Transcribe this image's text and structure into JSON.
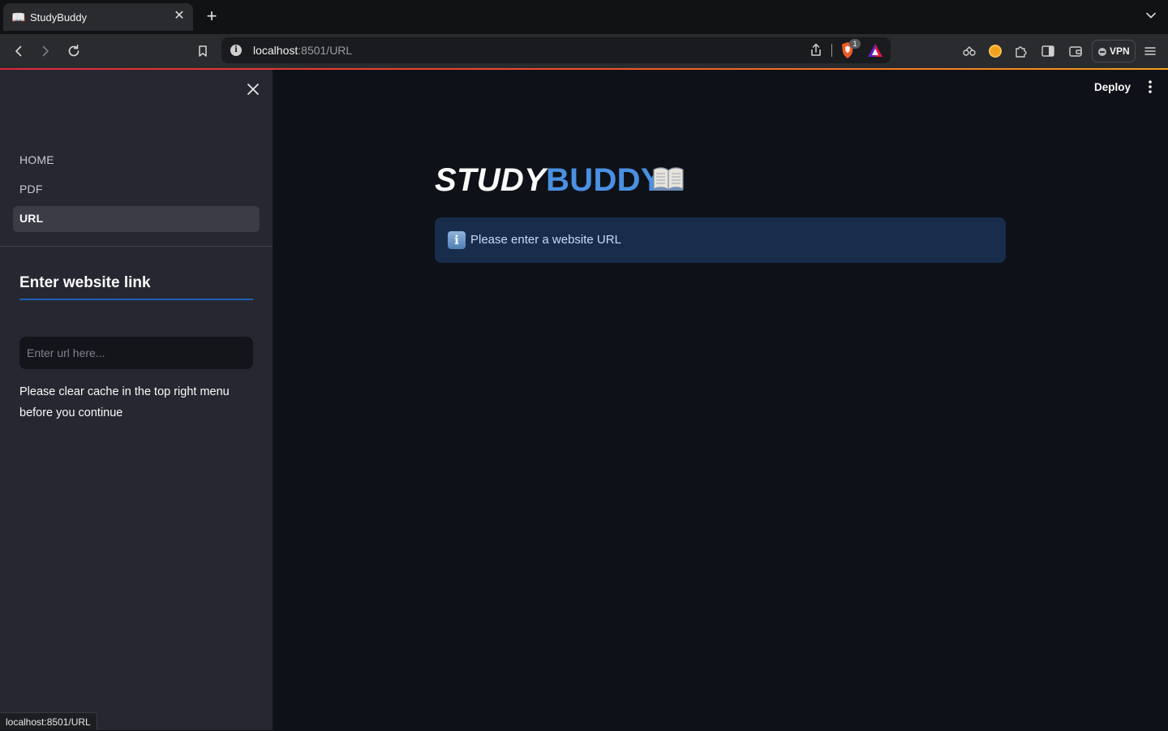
{
  "browser": {
    "tab": {
      "title": "StudyBuddy",
      "favicon": "open-book-icon"
    },
    "address": {
      "host": "localhost",
      "rest": ":8501/URL"
    },
    "shield_count": "1",
    "vpn_label": "VPN",
    "status_url": "localhost:8501/URL",
    "colors": {
      "progress_start": "#e0263a",
      "progress_end": "#f5a21f"
    }
  },
  "app": {
    "deploy_label": "Deploy",
    "title": {
      "part1": "STUDY",
      "part2": "BUDDY"
    },
    "info_message": "Please enter a website URL",
    "colors": {
      "accent_blue": "#4a90e2",
      "info_bg": "#172d4b",
      "sidebar_bg": "#262730",
      "main_bg": "#0e1117"
    }
  },
  "sidebar": {
    "nav_items": [
      {
        "label": "HOME",
        "active": false
      },
      {
        "label": "PDF",
        "active": false
      },
      {
        "label": "URL",
        "active": true
      }
    ],
    "header": "Enter website link",
    "input": {
      "placeholder": "Enter url here...",
      "value": ""
    },
    "note": "Please clear cache in the top right menu before you continue"
  }
}
